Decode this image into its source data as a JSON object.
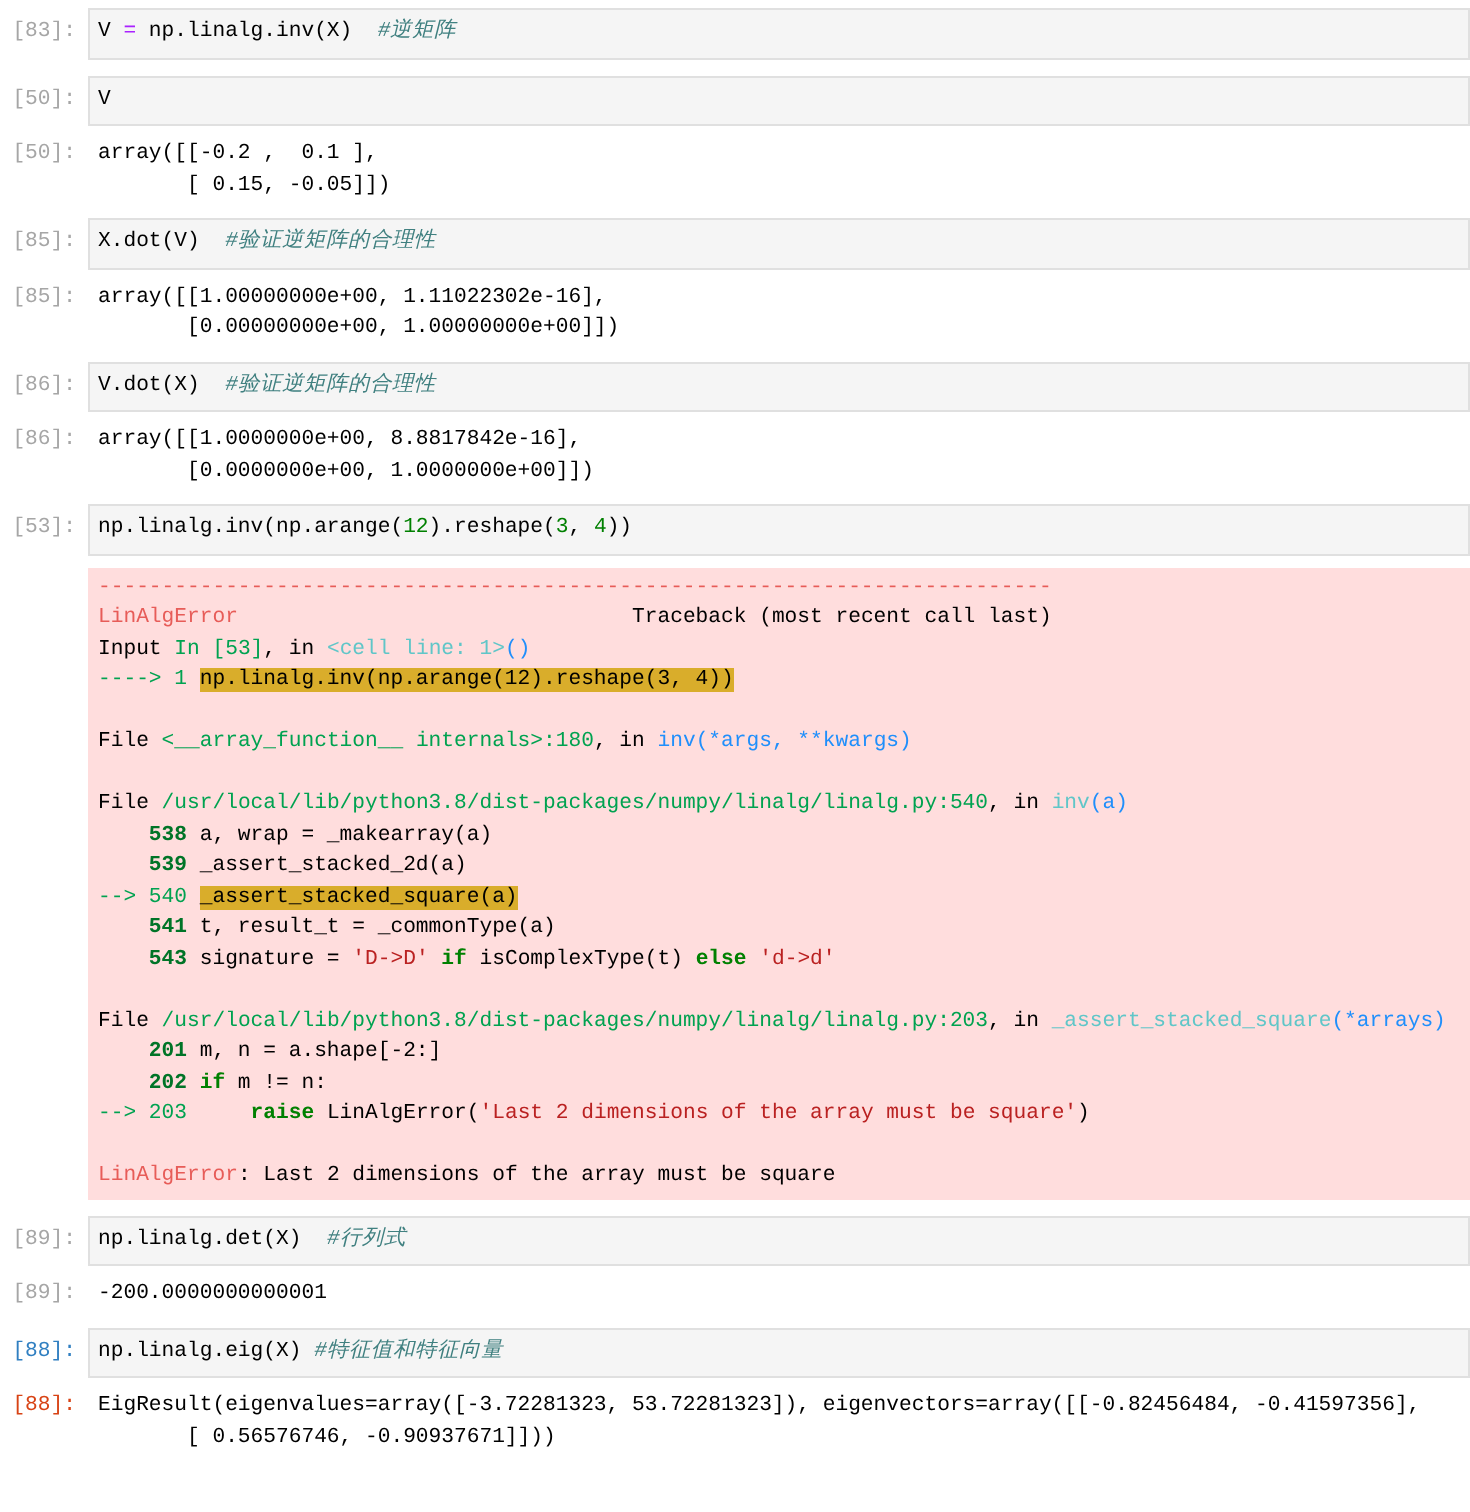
{
  "cells": [
    {
      "selected": false,
      "input": {
        "prompt": "[83]:",
        "code": [
          {
            "kind": "name",
            "text": "V "
          },
          {
            "kind": "op",
            "text": "="
          },
          {
            "kind": "name",
            "text": " np.linalg.inv(X)  "
          },
          {
            "kind": "comment",
            "text": "#逆矩阵"
          }
        ]
      }
    },
    {
      "selected": false,
      "input": {
        "prompt": "[50]:",
        "code": [
          {
            "kind": "name",
            "text": "V"
          }
        ]
      },
      "output": {
        "prompt": "[50]:",
        "lines": [
          "array([[-0.2 ,  0.1 ],",
          "       [ 0.15, -0.05]])"
        ]
      }
    },
    {
      "selected": false,
      "input": {
        "prompt": "[85]:",
        "code": [
          {
            "kind": "name",
            "text": "X.dot(V)  "
          },
          {
            "kind": "comment",
            "text": "#验证逆矩阵的合理性"
          }
        ]
      },
      "output": {
        "prompt": "[85]:",
        "lines": [
          "array([[1.00000000e+00, 1.11022302e-16],",
          "       [0.00000000e+00, 1.00000000e+00]])"
        ]
      }
    },
    {
      "selected": false,
      "input": {
        "prompt": "[86]:",
        "code": [
          {
            "kind": "name",
            "text": "V.dot(X)  "
          },
          {
            "kind": "comment",
            "text": "#验证逆矩阵的合理性"
          }
        ]
      },
      "output": {
        "prompt": "[86]:",
        "lines": [
          "array([[1.0000000e+00, 8.8817842e-16],",
          "       [0.0000000e+00, 1.0000000e+00]])"
        ]
      }
    },
    {
      "selected": false,
      "input": {
        "prompt": "[53]:",
        "code": [
          {
            "kind": "name",
            "text": "np.linalg.inv(np.arange("
          },
          {
            "kind": "number",
            "text": "12"
          },
          {
            "kind": "name",
            "text": ").reshape("
          },
          {
            "kind": "number",
            "text": "3"
          },
          {
            "kind": "name",
            "text": ", "
          },
          {
            "kind": "number",
            "text": "4"
          },
          {
            "kind": "name",
            "text": "))"
          }
        ]
      },
      "traceback": [
        [
          [
            {
              "kind": "error",
              "text": "---------------------------------------------------------------------------"
            }
          ],
          [
            {
              "kind": "error",
              "text": "LinAlgError"
            },
            {
              "kind": "plain",
              "text": "                               Traceback (most recent call last)"
            }
          ],
          [
            {
              "kind": "plain",
              "text": "Input "
            },
            {
              "kind": "green",
              "text": "In [53]"
            },
            {
              "kind": "plain",
              "text": ", in "
            },
            {
              "kind": "cyan",
              "text": "<cell line: 1>"
            },
            {
              "kind": "blue",
              "text": "()"
            }
          ],
          [
            {
              "kind": "green",
              "text": "----> 1 "
            },
            {
              "kind": "highlight",
              "text": "np.linalg.inv(np.arange(12).reshape(3, 4))"
            }
          ]
        ],
        [
          [
            {
              "kind": "plain",
              "text": "File "
            },
            {
              "kind": "green",
              "text": "<__array_function__ internals>:180"
            },
            {
              "kind": "plain",
              "text": ", in "
            },
            {
              "kind": "blue",
              "text": "inv(*args, **kwargs)"
            }
          ]
        ],
        [
          [
            {
              "kind": "plain",
              "text": "File "
            },
            {
              "kind": "green",
              "text": "/usr/local/lib/python3.8/dist-packages/numpy/linalg/linalg.py:540"
            },
            {
              "kind": "plain",
              "text": ", in "
            },
            {
              "kind": "cyan",
              "text": "inv"
            },
            {
              "kind": "blue",
              "text": "(a)"
            }
          ],
          [
            {
              "kind": "lineno",
              "text": "    538 "
            },
            {
              "kind": "plain",
              "text": "a, wrap = _makearray(a)"
            }
          ],
          [
            {
              "kind": "lineno",
              "text": "    539 "
            },
            {
              "kind": "plain",
              "text": "_assert_stacked_2d(a)"
            }
          ],
          [
            {
              "kind": "green",
              "text": "--> 540 "
            },
            {
              "kind": "highlight",
              "text": "_assert_stacked_square(a)"
            }
          ],
          [
            {
              "kind": "lineno",
              "text": "    541 "
            },
            {
              "kind": "plain",
              "text": "t, result_t = _commonType(a)"
            }
          ],
          [
            {
              "kind": "lineno",
              "text": "    543 "
            },
            {
              "kind": "plain",
              "text": "signature = "
            },
            {
              "kind": "string",
              "text": "'D->D'"
            },
            {
              "kind": "keyword",
              "text": " if"
            },
            {
              "kind": "plain",
              "text": " isComplexType(t) "
            },
            {
              "kind": "keyword",
              "text": "else"
            },
            {
              "kind": "string",
              "text": " 'd->d'"
            }
          ]
        ],
        [
          [
            {
              "kind": "plain",
              "text": "File "
            },
            {
              "kind": "green",
              "text": "/usr/local/lib/python3.8/dist-packages/numpy/linalg/linalg.py:203"
            },
            {
              "kind": "plain",
              "text": ", in "
            },
            {
              "kind": "cyan",
              "text": "_assert_stacked_square"
            },
            {
              "kind": "blue",
              "text": "(*arrays)"
            }
          ],
          [
            {
              "kind": "lineno",
              "text": "    201 "
            },
            {
              "kind": "plain",
              "text": "m, n = a.shape[-2:]"
            }
          ],
          [
            {
              "kind": "lineno",
              "text": "    202 "
            },
            {
              "kind": "keyword",
              "text": "if"
            },
            {
              "kind": "plain",
              "text": " m != n:"
            }
          ],
          [
            {
              "kind": "green",
              "text": "--> 203     "
            },
            {
              "kind": "keyword",
              "text": "raise"
            },
            {
              "kind": "plain",
              "text": " LinAlgError("
            },
            {
              "kind": "string",
              "text": "'Last 2 dimensions of the array must be square'"
            },
            {
              "kind": "plain",
              "text": ")"
            }
          ]
        ],
        [
          [
            {
              "kind": "error",
              "text": "LinAlgError"
            },
            {
              "kind": "plain",
              "text": ": Last 2 dimensions of the array must be square"
            }
          ]
        ]
      ]
    },
    {
      "selected": false,
      "input": {
        "prompt": "[89]:",
        "code": [
          {
            "kind": "name",
            "text": "np.linalg.det(X)  "
          },
          {
            "kind": "comment",
            "text": "#行列式"
          }
        ]
      },
      "output": {
        "prompt": "[89]:",
        "lines": [
          "-200.0000000000001"
        ]
      }
    },
    {
      "selected": true,
      "input": {
        "prompt": "[88]:",
        "code": [
          {
            "kind": "name",
            "text": "np.linalg.eig(X) "
          },
          {
            "kind": "comment",
            "text": "#特征值和特征向量"
          }
        ]
      },
      "output": {
        "prompt": "[88]:",
        "lines": [
          "EigResult(eigenvalues=array([-3.72281323, 53.72281323]), eigenvectors=array([[-0.82456484, -0.41597356],",
          "       [ 0.56576746, -0.90937671]]))"
        ]
      }
    }
  ]
}
